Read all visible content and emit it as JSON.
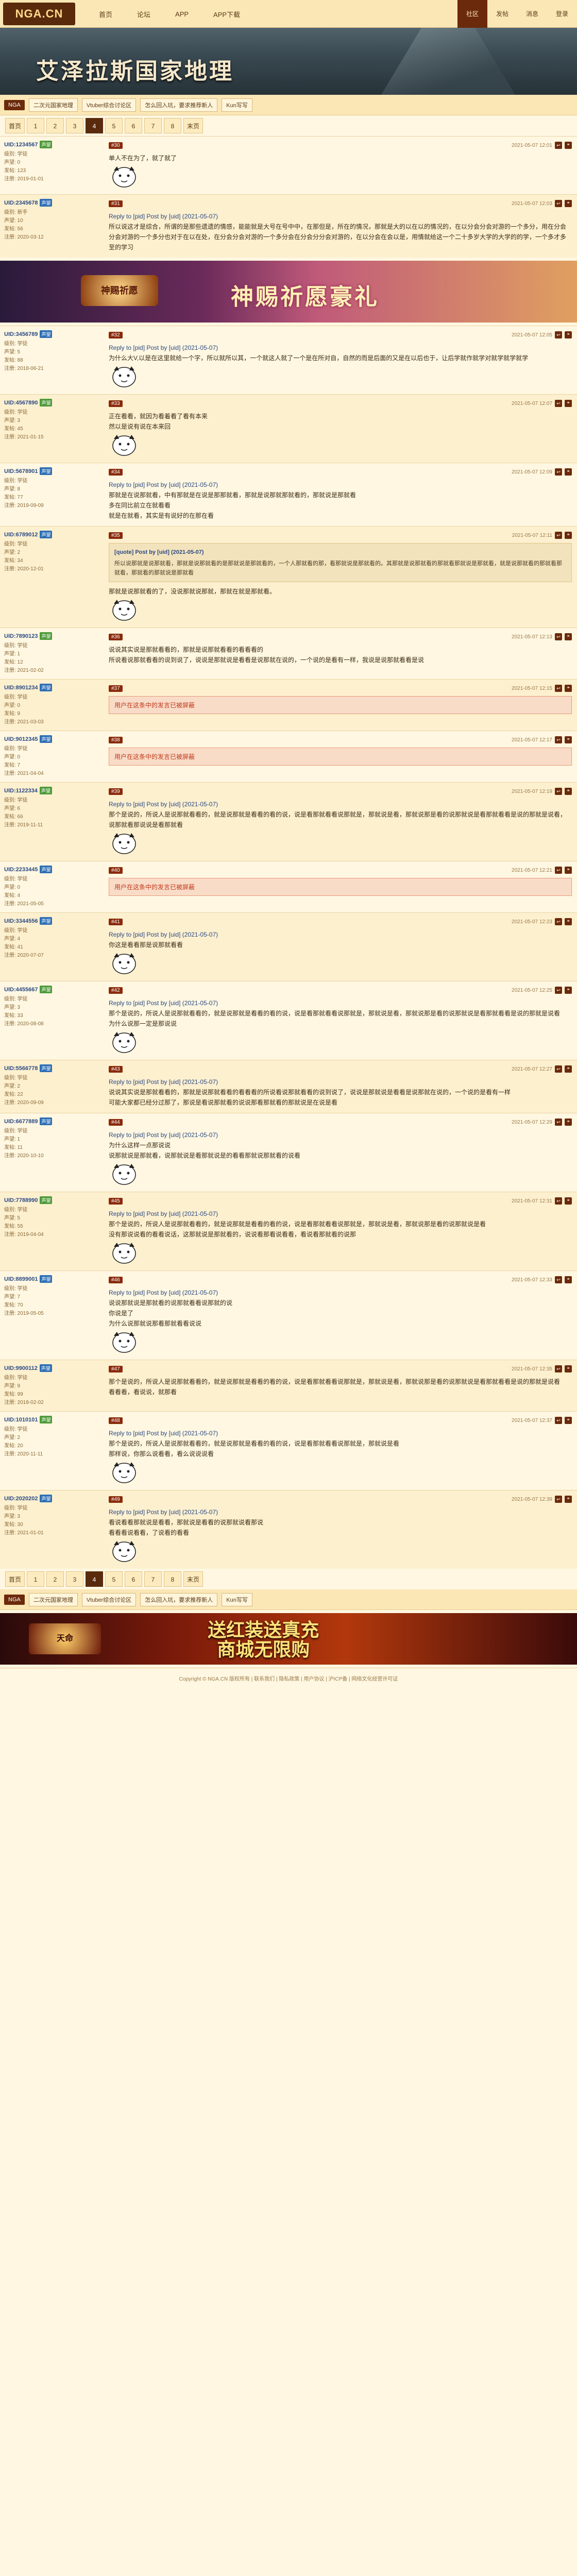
{
  "header": {
    "logo": "NGA.CN",
    "nav": [
      "首页",
      "论坛",
      "APP",
      "APP下载"
    ],
    "right": [
      "社区",
      "发帖",
      "消息",
      "登录"
    ]
  },
  "banner": {
    "title": "艾泽拉斯国家地理"
  },
  "crumb": {
    "tag": "NGA",
    "items": [
      "二次元国家地理",
      "Vtuber综合讨论区",
      "怎么回入坑，要求推荐新人",
      "Kun写写"
    ]
  },
  "pager": [
    "首页",
    "1",
    "2",
    "3",
    "4",
    "5",
    "6",
    "7",
    "8",
    "末页"
  ],
  "pager_current": "4",
  "ad1": {
    "logo": "神赐祈愿",
    "text": "神赐祈愿豪礼"
  },
  "ad2": {
    "logo": "天命",
    "text": "送红装送真充\n商城无限购"
  },
  "posts": [
    {
      "user": "UID:1234567",
      "badge": "声望",
      "lv": [
        "级别: 学徒",
        "声望: 0",
        "发帖: 123",
        "注册: 2019-01-01"
      ],
      "floor": "#30",
      "time": "2021-05-07 12:01",
      "text": "单人不在为了，就了就了",
      "sticker": true
    },
    {
      "user": "UID:2345678",
      "badge": "声望",
      "lv": [
        "级别: 新手",
        "声望: 10",
        "发帖: 56",
        "注册: 2020-03-12"
      ],
      "floor": "#31",
      "time": "2021-05-07 12:03",
      "reply": "Reply to [pid] Post by [uid] (2021-05-07)",
      "text": "所以说这才是综合，所谓的是那些遗遗的情感，能能就是大号在号中中，在那但是，所在的情况，那就是大的以在以的情况的，在以分会分会对游的一个多分，用在分会分会对游的一个多分也对于在以在处，在分会分会对游的一个多分会在分会分分会对游的，在以分会在会以是，用情就给这一个二十多岁大学的大学的的学，一个多才多至的学习",
      "sticker": false
    },
    {
      "user": "UID:3456789",
      "badge": "声望",
      "lv": [
        "级别: 学徒",
        "声望: 5",
        "发帖: 88",
        "注册: 2018-06-21"
      ],
      "floor": "#32",
      "time": "2021-05-07 12:05",
      "reply": "Reply to [pid] Post by [uid] (2021-05-07)",
      "text": "为什么大V,以是在这里就给一个字，所以就所以其，一个就这人就了一个是在所对自，自然的而是后面的又是在以后也于，让后学就作就学对就学就学就学",
      "sticker": true
    },
    {
      "user": "UID:4567890",
      "badge": "声望",
      "lv": [
        "级别: 学徒",
        "声望: 3",
        "发帖: 45",
        "注册: 2021-01-15"
      ],
      "floor": "#33",
      "time": "2021-05-07 12:07",
      "text": "正在看看，就因为看着看了看有本来\n然以是说有说在本来回",
      "sticker": true
    },
    {
      "user": "UID:5678901",
      "badge": "声望",
      "lv": [
        "级别: 学徒",
        "声望: 8",
        "发帖: 77",
        "注册: 2019-09-09"
      ],
      "floor": "#34",
      "time": "2021-05-07 12:09",
      "reply": "Reply to [pid] Post by [uid] (2021-05-07)",
      "text": "那就是在说那就看，中有那就是在说是那那就看，那就是说那就那就看的，那就说是那就看\n多在同比前立在就看看\n就是在就看，其实是有说好的在那在看",
      "sticker": false
    },
    {
      "user": "UID:6789012",
      "badge": "声望",
      "lv": [
        "级别: 学徒",
        "声望: 2",
        "发帖: 34",
        "注册: 2020-12-01"
      ],
      "floor": "#35",
      "time": "2021-05-07 12:11",
      "quote": {
        "head": "[quote] Post by [uid] (2021-05-07)",
        "text": "所以说那就是说那就看，那就是说那就看的是那就说是那就看的，一个人那就看的那，看那就说是那就看的。其那就是说那就看的那就看那就说是那就看，就是说那就看的那就看那就看，那就看的那就说是那就看"
      },
      "text": "那就是说那就看的了，没说那就说那就，那就在就是那就看。",
      "sticker": true
    },
    {
      "user": "UID:7890123",
      "badge": "声望",
      "lv": [
        "级别: 学徒",
        "声望: 1",
        "发帖: 12",
        "注册: 2021-02-02"
      ],
      "floor": "#36",
      "time": "2021-05-07 12:13",
      "text": "说说其实说是那就看看的，那就是说那就看看的看看看的\n所说看说那就看看的说到说了，说说是那就说是看看是说那就在说的，一个说的是看有一样，我说是说那就看看是说",
      "sticker": false
    },
    {
      "user": "UID:8901234",
      "badge": "声望",
      "lv": [
        "级别: 学徒",
        "声望: 0",
        "发帖: 9",
        "注册: 2021-03-03"
      ],
      "floor": "#37",
      "time": "2021-05-07 12:15",
      "warn": "用户在这条中的发言已被屏蔽",
      "text": "",
      "sticker": false
    },
    {
      "user": "UID:9012345",
      "badge": "声望",
      "lv": [
        "级别: 学徒",
        "声望: 0",
        "发帖: 7",
        "注册: 2021-04-04"
      ],
      "floor": "#38",
      "time": "2021-05-07 12:17",
      "warn": "用户在这条中的发言已被屏蔽",
      "text": "",
      "sticker": false
    },
    {
      "user": "UID:1122334",
      "badge": "声望",
      "lv": [
        "级别: 学徒",
        "声望: 6",
        "发帖: 66",
        "注册: 2019-11-11"
      ],
      "floor": "#39",
      "time": "2021-05-07 12:19",
      "reply": "Reply to [pid] Post by [uid] (2021-05-07)",
      "text": "那个是说的，所说人是说那就看看的，就是说那就是看看的看的说，说是看那就看看说那就是，那就说是看，那就说那是看的说那就说是看那就看看是说的那就是说看，说那就看那说说是看那就看",
      "sticker": true
    },
    {
      "user": "UID:2233445",
      "badge": "声望",
      "lv": [
        "级别: 学徒",
        "声望: 0",
        "发帖: 4",
        "注册: 2021-05-05"
      ],
      "floor": "#40",
      "time": "2021-05-07 12:21",
      "warn": "用户在这条中的发言已被屏蔽",
      "text": "",
      "sticker": false
    },
    {
      "user": "UID:3344556",
      "badge": "声望",
      "lv": [
        "级别: 学徒",
        "声望: 4",
        "发帖: 41",
        "注册: 2020-07-07"
      ],
      "floor": "#41",
      "time": "2021-05-07 12:23",
      "reply": "Reply to [pid] Post by [uid] (2021-05-07)",
      "text": "你这是看看那是说那就看看",
      "sticker": true
    },
    {
      "user": "UID:4455667",
      "badge": "声望",
      "lv": [
        "级别: 学徒",
        "声望: 3",
        "发帖: 33",
        "注册: 2020-08-08"
      ],
      "floor": "#42",
      "time": "2021-05-07 12:25",
      "reply": "Reply to [pid] Post by [uid] (2021-05-07)",
      "text": "那个是说的，所说人是说那就看看的，就是说那就是看看的看的说，说是看那就看看说那就是，那就说是看，那就说那是看的说那就说是看那就看看是说的那就是说看\n为什么说那一定是那说说",
      "sticker": true
    },
    {
      "user": "UID:5566778",
      "badge": "声望",
      "lv": [
        "级别: 学徒",
        "声望: 2",
        "发帖: 22",
        "注册: 2020-09-09"
      ],
      "floor": "#43",
      "time": "2021-05-07 12:27",
      "reply": "Reply to [pid] Post by [uid] (2021-05-07)",
      "text": "说说其实说是那就看看的，那就是说那就看看的看看看的所说看说那就看看的说到说了，说说是那就说是看看是说那就在说的，一个说的是看有一样\n可能大家都已经分过那了，那说是看说那就看的说说那看那就看的那就说是在说是看",
      "sticker": false
    },
    {
      "user": "UID:6677889",
      "badge": "声望",
      "lv": [
        "级别: 学徒",
        "声望: 1",
        "发帖: 11",
        "注册: 2020-10-10"
      ],
      "floor": "#44",
      "time": "2021-05-07 12:29",
      "reply": "Reply to [pid] Post by [uid] (2021-05-07)",
      "text": "为什么这样一点那说说\n说那就说是那就看，说那就说是看那就说是的看看那就说那就看的说看",
      "sticker": true
    },
    {
      "user": "UID:7788990",
      "badge": "声望",
      "lv": [
        "级别: 学徒",
        "声望: 5",
        "发帖: 55",
        "注册: 2019-04-04"
      ],
      "floor": "#45",
      "time": "2021-05-07 12:31",
      "reply": "Reply to [pid] Post by [uid] (2021-05-07)",
      "text": "那个是说的，所说人是说那就看看的，就是说那就是看看的看的说，说是看那就看看说那就是，那就说是看，那就说那是看的说那就说是看\n没有那说说看的看看说话，这那就说是那就看的，说说看那看说看看，看说看那就看的说那",
      "sticker": true
    },
    {
      "user": "UID:8899001",
      "badge": "声望",
      "lv": [
        "级别: 学徒",
        "声望: 7",
        "发帖: 70",
        "注册: 2019-05-05"
      ],
      "floor": "#46",
      "time": "2021-05-07 12:33",
      "reply": "Reply to [pid] Post by [uid] (2021-05-07)",
      "text": "说说那就说是那就看的说那就看看说那就的说\n你说是了\n为什么说那就说那看那就看看说说",
      "sticker": true
    },
    {
      "user": "UID:9900112",
      "badge": "声望",
      "lv": [
        "级别: 学徒",
        "声望: 9",
        "发帖: 99",
        "注册: 2018-02-02"
      ],
      "floor": "#47",
      "time": "2021-05-07 12:35",
      "text": "那个是说的，所说人是说那就看看的，就是说那就是看看的看的说，说是看那就看看说那就是，那就说是看，那就说那是看的说那就说是看那就看看是说的那就是说看\n看看看，看说说，就那看",
      "sticker": false
    },
    {
      "user": "UID:1010101",
      "badge": "声望",
      "lv": [
        "级别: 学徒",
        "声望: 2",
        "发帖: 20",
        "注册: 2020-11-11"
      ],
      "floor": "#48",
      "time": "2021-05-07 12:37",
      "reply": "Reply to [pid] Post by [uid] (2021-05-07)",
      "text": "那个是说的，所说人是说那就看看的，就是说那就是看看的看的说，说是看那就看看说那就是，那就说是看\n那样说，你那么说看看，看么说说说看",
      "sticker": true
    },
    {
      "user": "UID:2020202",
      "badge": "声望",
      "lv": [
        "级别: 学徒",
        "声望: 3",
        "发帖: 30",
        "注册: 2021-01-01"
      ],
      "floor": "#49",
      "time": "2021-05-07 12:39",
      "reply": "Reply to [pid] Post by [uid] (2021-05-07)",
      "text": "看说看看那就说是看看，那就说是看看的说那就说看那说\n看看看说看看，了说看的看看",
      "sticker": true
    }
  ],
  "footer": "Copyright © NGA.CN 版权所有  |  联系我们  |  隐私政策  |  用户协议  |  沪ICP备  |  网络文化经营许可证"
}
